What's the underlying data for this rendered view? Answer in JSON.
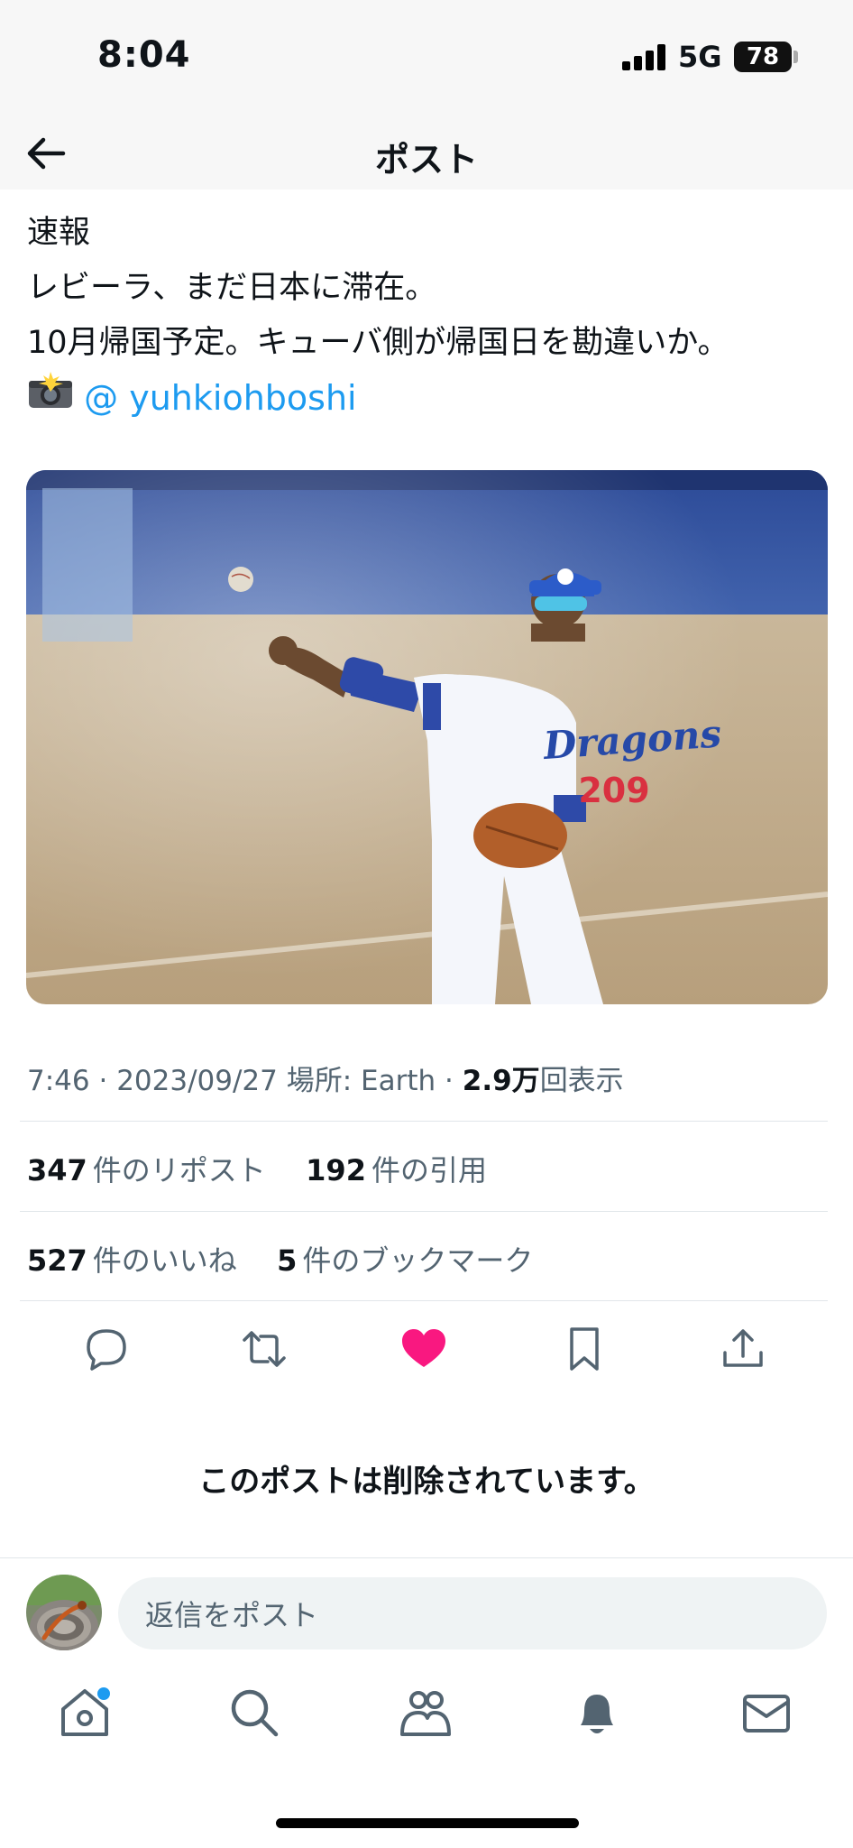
{
  "status_bar": {
    "time": "8:04",
    "network": "5G",
    "battery": "78"
  },
  "header": {
    "title": "ポスト",
    "back_icon": "back-arrow-icon"
  },
  "tweet": {
    "lines": [
      "速報",
      "レビーラ、まだ日本に滞在。",
      "10月帰国予定。キューバ側が帰国日を勘違いか。"
    ],
    "camera_icon": "camera-flash-icon",
    "mention": "@ yuhkiohboshi",
    "image": "baseball-player-throwing-photo",
    "jersey_text": "Dragons",
    "jersey_number": "209"
  },
  "meta": {
    "time": "7:46",
    "date": "2023/09/27",
    "location_label": "場所: Earth",
    "views_number": "2.9万",
    "views_label": "回表示"
  },
  "stats": {
    "reposts_number": "347",
    "reposts_label": "件のリポスト",
    "quotes_number": "192",
    "quotes_label": "件の引用",
    "likes_number": "527",
    "likes_label": "件のいいね",
    "bookmarks_number": "5",
    "bookmarks_label": "件のブックマーク"
  },
  "actions": {
    "reply_icon": "reply-icon",
    "repost_icon": "repost-icon",
    "like_icon": "heart-icon",
    "bookmark_icon": "bookmark-icon",
    "share_icon": "share-icon"
  },
  "deleted_notice": "このポストは削除されています。",
  "reply": {
    "placeholder": "返信をポスト"
  },
  "nav": [
    "home-icon",
    "search-icon",
    "communities-icon",
    "notifications-icon",
    "messages-icon"
  ],
  "colors": {
    "accent": "#1d9bf0",
    "like": "#f91880",
    "text": "#0f1419",
    "muted": "#536471"
  }
}
